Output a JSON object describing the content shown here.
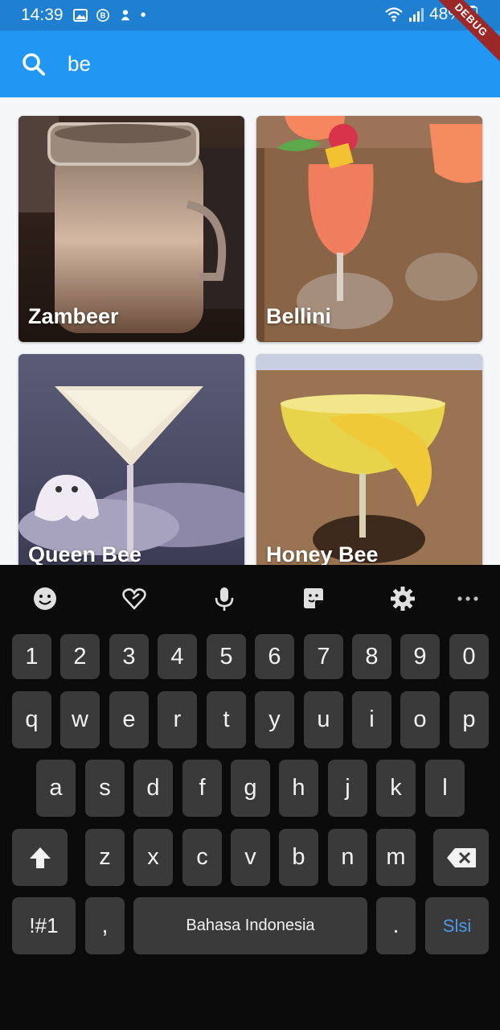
{
  "status_bar": {
    "time": "14:39",
    "battery": "48%",
    "debug_banner": "DEBUG"
  },
  "search": {
    "query": "be"
  },
  "results": [
    {
      "name": "Zambeer"
    },
    {
      "name": "Bellini"
    },
    {
      "name": "Queen Bee"
    },
    {
      "name": "Honey Bee"
    }
  ],
  "keyboard": {
    "toolbar": [
      "emoji-icon",
      "heart-sticker-icon",
      "microphone-icon",
      "sticker-icon",
      "settings-icon",
      "more-icon"
    ],
    "number_row": [
      "1",
      "2",
      "3",
      "4",
      "5",
      "6",
      "7",
      "8",
      "9",
      "0"
    ],
    "row1": [
      "q",
      "w",
      "e",
      "r",
      "t",
      "y",
      "u",
      "i",
      "o",
      "p"
    ],
    "row2": [
      "a",
      "s",
      "d",
      "f",
      "g",
      "h",
      "j",
      "k",
      "l"
    ],
    "row3": [
      "z",
      "x",
      "c",
      "v",
      "b",
      "n",
      "m"
    ],
    "symbols_key": "!#1",
    "comma_key": ",",
    "space_label": "Bahasa Indonesia",
    "period_key": ".",
    "enter_label": "Slsi"
  }
}
